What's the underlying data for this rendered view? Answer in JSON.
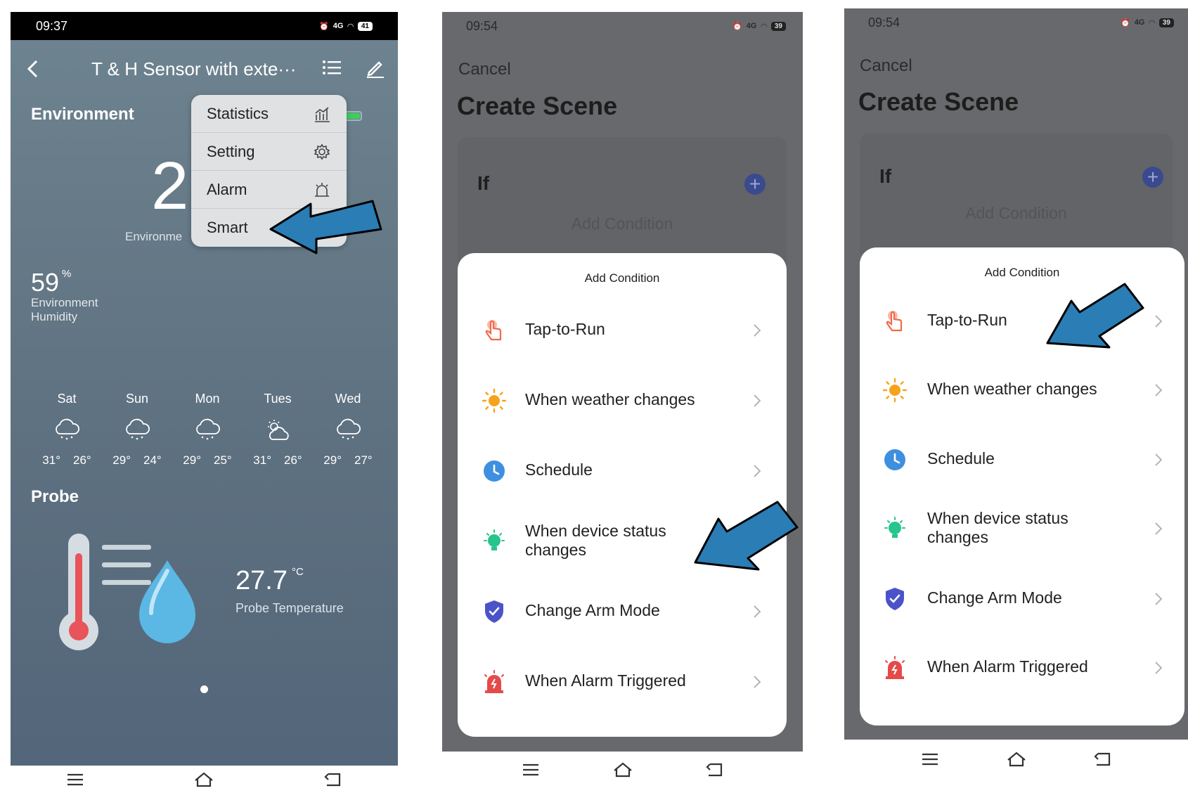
{
  "screen1": {
    "status_time": "09:37",
    "battery": "41",
    "network": "4G",
    "title": "T & H Sensor with exte···",
    "section_environment": "Environment",
    "big_temp_partial": "2",
    "env_label_partial": "Environme",
    "menu": [
      {
        "label": "Statistics",
        "icon": "bar-chart-icon"
      },
      {
        "label": "Setting",
        "icon": "gear-icon"
      },
      {
        "label": "Alarm",
        "icon": "alarm-siren-icon"
      },
      {
        "label": "Smart",
        "icon": ""
      }
    ],
    "humidity_value": "59",
    "humidity_unit": "%",
    "humidity_label_1": "Environment",
    "humidity_label_2": "Humidity",
    "forecast": [
      {
        "day": "Sat",
        "high": "31°",
        "low": "26°",
        "icon": "rain-cloud-icon"
      },
      {
        "day": "Sun",
        "high": "29°",
        "low": "24°",
        "icon": "rain-cloud-icon"
      },
      {
        "day": "Mon",
        "high": "29°",
        "low": "25°",
        "icon": "rain-cloud-icon"
      },
      {
        "day": "Tues",
        "high": "31°",
        "low": "26°",
        "icon": "sun-cloud-icon"
      },
      {
        "day": "Wed",
        "high": "29°",
        "low": "27°",
        "icon": "rain-cloud-icon"
      }
    ],
    "probe_heading": "Probe",
    "probe_value": "27.7",
    "probe_unit": "°C",
    "probe_label": "Probe Temperature"
  },
  "screen2": {
    "status_time": "09:54",
    "battery": "39",
    "cancel": "Cancel",
    "title": "Create Scene",
    "if_label": "If",
    "add_condition_bg": "Add Condition",
    "sheet_title": "Add Condition",
    "options": [
      {
        "label": "Tap-to-Run",
        "icon": "tap-hand-icon",
        "color": "#f06a4a"
      },
      {
        "label": "When weather changes",
        "icon": "sun-icon",
        "color": "#f7a21b"
      },
      {
        "label": "Schedule",
        "icon": "clock-icon",
        "color": "#3f8fe0"
      },
      {
        "label_1": "When device status",
        "label_2": "changes",
        "icon": "bulb-icon",
        "color": "#27c48b"
      },
      {
        "label": "Change Arm Mode",
        "icon": "shield-check-icon",
        "color": "#4b53c9"
      },
      {
        "label": "When Alarm Triggered",
        "icon": "alarm-siren-icon",
        "color": "#e54a4a"
      }
    ]
  },
  "screen3": {
    "status_time": "09:54",
    "battery": "39",
    "cancel": "Cancel",
    "title": "Create Scene",
    "if_label": "If",
    "add_condition_bg": "Add Condition",
    "sheet_title": "Add Condition",
    "options": [
      {
        "label": "Tap-to-Run"
      },
      {
        "label": "When weather changes"
      },
      {
        "label": "Schedule"
      },
      {
        "label_1": "When device status",
        "label_2": "changes"
      },
      {
        "label": "Change Arm Mode"
      },
      {
        "label": "When Alarm Triggered"
      }
    ]
  },
  "colors": {
    "annotation_arrow": "#2a7db5",
    "plus_button": "#3b4a8e"
  }
}
